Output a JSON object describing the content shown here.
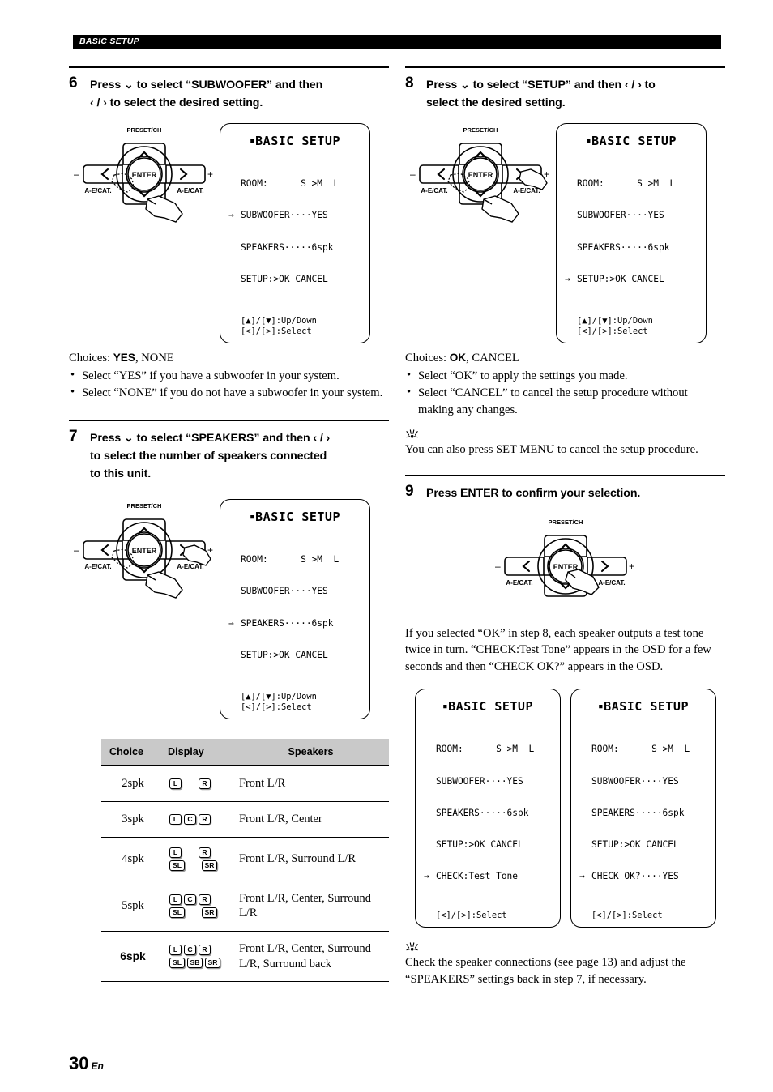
{
  "header": {
    "section_label": "BASIC SETUP"
  },
  "footer": {
    "page_number": "30",
    "language": "En"
  },
  "remote": {
    "preset_label": "PRESET/CH",
    "enter_label": "ENTER",
    "left_cat_label": "A-E/CAT.",
    "right_cat_label": "A-E/CAT.",
    "minus_label": "–",
    "plus_label": "+"
  },
  "steps": [
    {
      "number": "6",
      "title_line1": "Press ⌄ to select “SUBWOOFER” and then",
      "title_line2": "‹ / › to select the desired setting.",
      "osd": {
        "title": "BASIC SETUP",
        "lines": [
          {
            "caret": "",
            "text": "ROOM:      S >M  L"
          },
          {
            "caret": "→",
            "text": "SUBWOOFER····YES"
          },
          {
            "caret": "",
            "text": "SPEAKERS·····6spk"
          },
          {
            "caret": "",
            "text": "SETUP:>OK CANCEL"
          }
        ],
        "foot_line1": "[▲]/[▼]:Up/Down",
        "foot_line2": "[<]/[>]:Select"
      },
      "choices_label": "Choices:",
      "choices_bold": "YES",
      "choices_rest": ", NONE",
      "bullets": [
        "Select “YES” if you have a subwoofer in your system.",
        "Select “NONE” if you do not have a subwoofer in your system."
      ]
    },
    {
      "number": "7",
      "title_line1": "Press ⌄ to select “SPEAKERS” and then ‹ / ›",
      "title_line2": "to select the number of speakers connected",
      "title_line3": "to this unit.",
      "osd": {
        "title": "BASIC SETUP",
        "lines": [
          {
            "caret": "",
            "text": "ROOM:      S >M  L"
          },
          {
            "caret": "",
            "text": "SUBWOOFER····YES"
          },
          {
            "caret": "→",
            "text": "SPEAKERS·····6spk"
          },
          {
            "caret": "",
            "text": "SETUP:>OK CANCEL"
          }
        ],
        "foot_line1": "[▲]/[▼]:Up/Down",
        "foot_line2": "[<]/[>]:Select"
      }
    },
    {
      "number": "8",
      "title_line1": "Press ⌄ to select “SETUP” and then ‹ / › to",
      "title_line2": "select the desired setting.",
      "osd": {
        "title": "BASIC SETUP",
        "lines": [
          {
            "caret": "",
            "text": "ROOM:      S >M  L"
          },
          {
            "caret": "",
            "text": "SUBWOOFER····YES"
          },
          {
            "caret": "",
            "text": "SPEAKERS·····6spk"
          },
          {
            "caret": "→",
            "text": "SETUP:>OK CANCEL"
          }
        ],
        "foot_line1": "[▲]/[▼]:Up/Down",
        "foot_line2": "[<]/[>]:Select"
      },
      "choices_label": "Choices:",
      "choices_bold": "OK",
      "choices_rest": ", CANCEL",
      "bullets": [
        "Select “OK” to apply the settings you made.",
        "Select “CANCEL” to cancel the setup procedure without making any changes."
      ],
      "tip": "You can also press SET MENU to cancel the setup procedure."
    },
    {
      "number": "9",
      "title_line1": "Press ENTER to confirm your selection.",
      "body": "If you selected “OK” in step 8, each speaker outputs a test tone twice in turn. “CHECK:Test Tone” appears in the OSD for a few seconds and then “CHECK OK?” appears in the OSD.",
      "osd_left": {
        "title": "BASIC SETUP",
        "lines": [
          {
            "caret": "",
            "text": "ROOM:      S >M  L"
          },
          {
            "caret": "",
            "text": "SUBWOOFER····YES"
          },
          {
            "caret": "",
            "text": "SPEAKERS·····6spk"
          },
          {
            "caret": "",
            "text": "SETUP:>OK CANCEL"
          },
          {
            "caret": "→",
            "text": "CHECK:Test Tone"
          }
        ],
        "foot_line1": "[<]/[>]:Select"
      },
      "osd_right": {
        "title": "BASIC SETUP",
        "lines": [
          {
            "caret": "",
            "text": "ROOM:      S >M  L"
          },
          {
            "caret": "",
            "text": "SUBWOOFER····YES"
          },
          {
            "caret": "",
            "text": "SPEAKERS·····6spk"
          },
          {
            "caret": "",
            "text": "SETUP:>OK CANCEL"
          },
          {
            "caret": "→",
            "text": "CHECK OK?····YES"
          }
        ],
        "foot_line1": "[<]/[>]:Select"
      },
      "tip": "Check the speaker connections (see page 13) and adjust the “SPEAKERS” settings back in step 7, if necessary."
    }
  ],
  "speaker_table": {
    "columns": [
      "Choice",
      "Display",
      "Speakers"
    ],
    "rows": [
      {
        "choice": "2spk",
        "top_chips": [
          "L",
          "",
          "R"
        ],
        "bottom_chips": [],
        "speakers": "Front L/R",
        "emphasis": false
      },
      {
        "choice": "3spk",
        "top_chips": [
          "L",
          "C",
          "R"
        ],
        "bottom_chips": [],
        "speakers": "Front L/R, Center",
        "emphasis": false
      },
      {
        "choice": "4spk",
        "top_chips": [
          "L",
          "",
          "R"
        ],
        "bottom_chips": [
          "SL",
          "",
          "SR"
        ],
        "speakers": "Front L/R, Surround L/R",
        "emphasis": false
      },
      {
        "choice": "5spk",
        "top_chips": [
          "L",
          "C",
          "R"
        ],
        "bottom_chips": [
          "SL",
          "",
          "SR"
        ],
        "speakers": "Front L/R, Center, Surround L/R",
        "emphasis": false
      },
      {
        "choice": "6spk",
        "top_chips": [
          "L",
          "C",
          "R"
        ],
        "bottom_chips": [
          "SL",
          "SB",
          "SR"
        ],
        "speakers": "Front L/R, Center, Surround L/R, Surround back",
        "emphasis": true
      }
    ]
  }
}
